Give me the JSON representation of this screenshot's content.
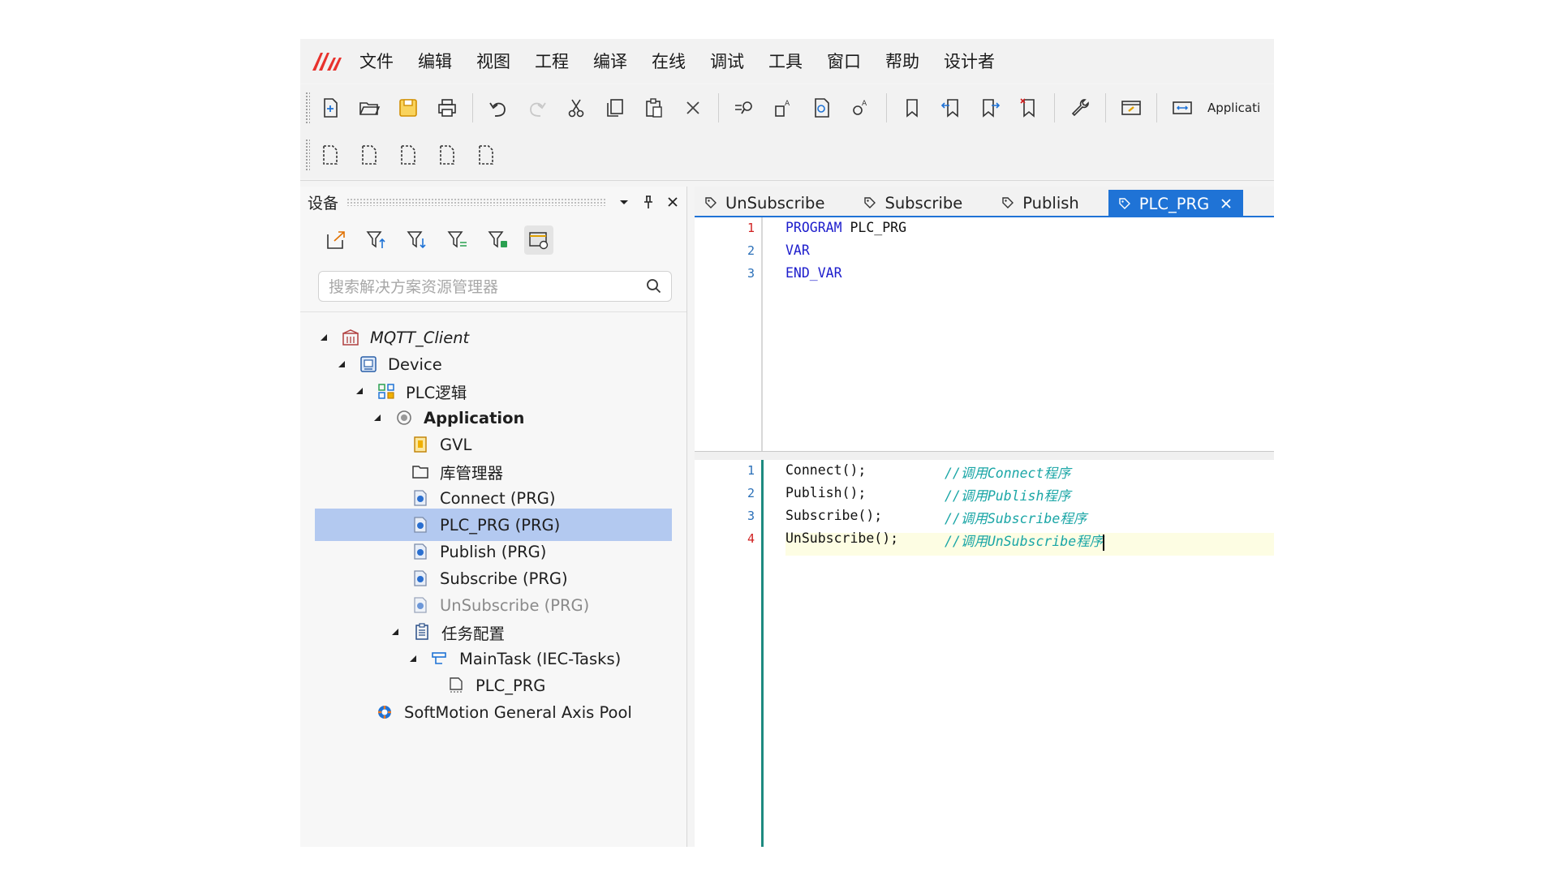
{
  "menu": {
    "items": [
      "文件",
      "编辑",
      "视图",
      "工程",
      "编译",
      "在线",
      "调试",
      "工具",
      "窗口",
      "帮助",
      "设计者"
    ]
  },
  "toolbar": {
    "application_label": "Applicati"
  },
  "device_pane": {
    "title": "设备",
    "search_placeholder": "搜索解决方案资源管理器",
    "tree": [
      {
        "label": "MQTT_Client",
        "icon": "project-icon"
      },
      {
        "label": "Device",
        "icon": "device-icon"
      },
      {
        "label": "PLC逻辑",
        "icon": "plc-logic-icon"
      },
      {
        "label": "Application",
        "icon": "application-icon"
      },
      {
        "label": "GVL",
        "icon": "gvl-icon"
      },
      {
        "label": "库管理器",
        "icon": "folder-icon"
      },
      {
        "label": "Connect (PRG)",
        "icon": "program-icon"
      },
      {
        "label": "PLC_PRG (PRG)",
        "icon": "program-icon",
        "selected": true
      },
      {
        "label": "Publish (PRG)",
        "icon": "program-icon"
      },
      {
        "label": "Subscribe (PRG)",
        "icon": "program-icon"
      },
      {
        "label": "UnSubscribe (PRG)",
        "icon": "program-icon"
      },
      {
        "label": "任务配置",
        "icon": "task-config-icon"
      },
      {
        "label": "MainTask (IEC-Tasks)",
        "icon": "task-icon"
      },
      {
        "label": "PLC_PRG",
        "icon": "program-call-icon"
      },
      {
        "label": "SoftMotion General Axis Pool",
        "icon": "axis-pool-icon"
      }
    ]
  },
  "editor": {
    "tabs": [
      {
        "label": "UnSubscribe"
      },
      {
        "label": "Subscribe"
      },
      {
        "label": "Publish"
      },
      {
        "label": "PLC_PRG",
        "active": true
      }
    ],
    "declaration": {
      "line_numbers": [
        "1",
        "2",
        "3"
      ],
      "lines": [
        "PROGRAM",
        "PLC_PRG",
        "VAR",
        "END_VAR"
      ]
    },
    "implementation": {
      "line_numbers": [
        "1",
        "2",
        "3",
        "4"
      ],
      "calls": [
        "Connect",
        "Publish",
        "Subscribe",
        "UnSubscribe"
      ],
      "call_suffix": "();",
      "comments": [
        "//调用Connect程序",
        "//调用Publish程序",
        "//调用Subscribe程序",
        "//调用UnSubscribe程序"
      ]
    }
  },
  "colors": {
    "accent": "#1f73d6",
    "selection": "#b3c9f0",
    "keyword": "#1d1dcc",
    "comment": "#1aa6a6",
    "logo": "#e8322d"
  }
}
